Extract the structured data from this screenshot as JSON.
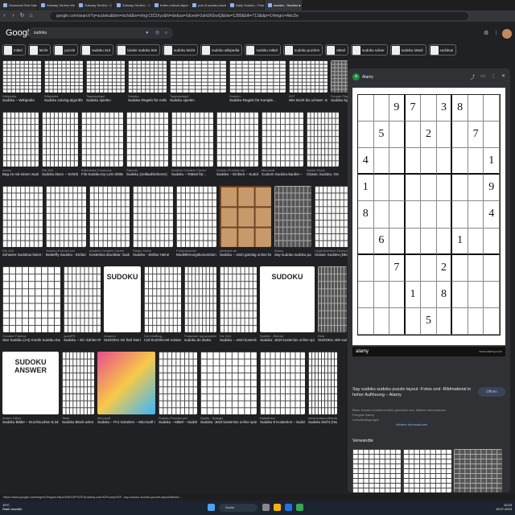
{
  "tabs": [
    {
      "label": "Download Sea Salon Shots Adam - Yo..."
    },
    {
      "label": "Subway Surfers World Tour 2023 - Ho..."
    },
    {
      "label": "Subway Surfers ‹ 1 2023 UR 8R.1.0"
    },
    {
      "label": "Subway Surfers - ‹ Fan..."
    },
    {
      "label": "fruiter-ordinal-object detection on ..."
    },
    {
      "label": "polo 8 sudoku-blank-d - Sudoku v..."
    },
    {
      "label": "Daily Sudoku - Fresh new puzzles 24/7"
    },
    {
      "label": "sudoku - Sudoku ● Google",
      "active": true
    }
  ],
  "address": {
    "url": "google.com/search?q=sudoku&tbm=isch&tbs=rimg:CfZ3Xyz&hl=de&sa=X&ved=2ahUKEwiQ&biw=1280&bih=713&dpr=1#imgrc=AbcDe"
  },
  "header": {
    "logo": "Google",
    "search_query": "sudoku"
  },
  "chips": [
    {
      "label": "mittel"
    },
    {
      "label": "leicht"
    },
    {
      "label": "puzzle"
    },
    {
      "label": "sudoku 3x3"
    },
    {
      "label": "kinder sudoku 9x9"
    },
    {
      "label": "sudoku leicht"
    },
    {
      "label": "sudoku wikipedia"
    },
    {
      "label": "sudoku mittel"
    },
    {
      "label": "sudoku puzzles"
    },
    {
      "label": "rätsel"
    },
    {
      "label": "sudoku solver"
    },
    {
      "label": "sudoku rätsel"
    },
    {
      "label": "sudokus"
    }
  ],
  "rows": [
    {
      "items": [
        {
          "source": "Wikipedia",
          "caption": "Sudoku – Wikipedia",
          "w": 48,
          "h": 40,
          "type": "grid"
        },
        {
          "source": "Wikipedia",
          "caption": "Sudoku solving algorithm...",
          "w": 48,
          "h": 40,
          "type": "grid"
        },
        {
          "source": "Tagesspiegel",
          "caption": "Sudoku spielen",
          "w": 48,
          "h": 40,
          "type": "grid"
        },
        {
          "source": "Sudoku",
          "caption": "Sudoku-Regeln für Anfäng...",
          "w": 48,
          "h": 40,
          "type": "grid"
        },
        {
          "source": "Tagesspiegel",
          "caption": "Sudoku spielen",
          "w": 70,
          "h": 40,
          "type": "grid"
        },
        {
          "source": "Sudoku",
          "caption": "Sudoku-Regeln für Komple...",
          "w": 70,
          "h": 40,
          "type": "grid"
        },
        {
          "source": "9GT",
          "caption": "Wie leicht bis schwer: Su...",
          "w": 48,
          "h": 40,
          "type": "grid"
        },
        {
          "source": "Google Play",
          "caption": "Sudoku by SF27 – Appo...",
          "w": 40,
          "h": 40,
          "type": "dark"
        }
      ]
    },
    {
      "items": [
        {
          "source": "Alamy",
          "caption": "Bag es mit einem Sudoku...",
          "w": 45,
          "h": 68,
          "type": "grid"
        },
        {
          "source": "Die Zeit",
          "caption": "Sudoku lösen – Schritt für...",
          "w": 45,
          "h": 68,
          "type": "grid"
        },
        {
          "source": "Wikimedia Commons",
          "caption": "File:Sudoku-by-L2G-20050...",
          "w": 52,
          "h": 68,
          "type": "grid"
        },
        {
          "source": "Stamatt",
          "caption": "Sudoku (zeitlaufsicheren) – Kanz...",
          "w": 52,
          "h": 68,
          "type": "grid"
        },
        {
          "source": "Another Creative Career",
          "caption": "Sudoku – Rätsel für...",
          "w": 52,
          "h": 68,
          "type": "grid"
        },
        {
          "source": "Sudoku Puzzles.net",
          "caption": "Sudoku – Einfach – Sudoku...",
          "w": 52,
          "h": 68,
          "type": "grid"
        },
        {
          "source": "Microsoft",
          "caption": "Custom Sudoku-kaufen – ...",
          "w": 52,
          "h": 68,
          "type": "grid"
        },
        {
          "source": "Adobe Stock",
          "caption": "Classic Sudoku. Grids with s...",
          "w": 40,
          "h": 68,
          "type": "grid"
        }
      ]
    },
    {
      "items": [
        {
          "source": "Die Zeit",
          "caption": "Schwere Sudokus lösen m...",
          "w": 50,
          "h": 76,
          "type": "grid"
        },
        {
          "source": "Sudoku-Puzzles.net",
          "caption": "Butterfly Sudoku - Einfach...",
          "w": 50,
          "h": 76,
          "type": "grid"
        },
        {
          "source": "Another Creative Career",
          "caption": "Kostenlos druckbar: Sudo...",
          "w": 50,
          "h": 76,
          "type": "grid"
        },
        {
          "source": "Stefan Heine",
          "caption": "Sudoku - Stefan Heine",
          "w": 50,
          "h": 76,
          "type": "grid"
        },
        {
          "source": "Freepresenter",
          "caption": "Modellierungskonventione...",
          "w": 50,
          "h": 76,
          "type": "grid"
        },
        {
          "source": "pinterest.de",
          "caption": "Sudoku – Jetzt günstig online bestelle...",
          "w": 64,
          "h": 76,
          "type": "wood"
        },
        {
          "source": "Alamy",
          "caption": "Say sudoku sudoku puzz...",
          "w": 46,
          "h": 76,
          "type": "dark"
        },
        {
          "source": "Leigh Breichen Deutschland",
          "caption": "Classic Sudoku (DE3) – Kil...",
          "w": 46,
          "h": 76,
          "type": "grid"
        }
      ]
    },
    {
      "items": [
        {
          "source": "Creative Fabrica",
          "caption": "Star Sudoku (A4) Kindle Sudoku Easy Stag...",
          "w": 72,
          "h": 82,
          "type": "grid"
        },
        {
          "source": "openPR",
          "caption": "Sudoku – Ein Zahlen-Rät...",
          "w": 46,
          "h": 82,
          "type": "grid"
        },
        {
          "source": "Amazon",
          "caption": "SUDOKU mit fünf Sterne...",
          "w": 46,
          "h": 82,
          "type": "text",
          "text": "SUDOKU"
        },
        {
          "source": "Die InfoBlog...",
          "caption": "Caf SUDOKUM Advanced",
          "w": 46,
          "h": 82,
          "type": "grid"
        },
        {
          "source": "Podadore wyrazowiemia",
          "caption": "sudoku de druku",
          "w": 40,
          "h": 82,
          "type": "grid"
        },
        {
          "source": "Die Zeit",
          "caption": "Sudoku – Jetzt kostenlos...",
          "w": 46,
          "h": 82,
          "type": "grid"
        },
        {
          "source": "Spielen - Bild.de",
          "caption": "Sudoku: Jetzt kostenlos online spielen",
          "w": 68,
          "h": 82,
          "type": "text",
          "text": "SUDOKU"
        },
        {
          "source": "Ekta",
          "caption": "SUDOKU 400 sudo...",
          "w": 36,
          "h": 82,
          "type": "dark"
        }
      ]
    },
    {
      "items": [
        {
          "source": "Amber Dillon",
          "caption": "Sudoku Bilder – Durchsuchen 8,348 Archiv...",
          "w": 70,
          "h": 78,
          "type": "text",
          "text": "SUDOKU ANSWER"
        },
        {
          "source": "Tobis",
          "caption": "Sudoku Block-arten...",
          "w": 40,
          "h": 78,
          "type": "grid"
        },
        {
          "source": "Microsoft",
          "caption": "Sudoku – Pro-Sobeilen – Microsoft Store de...",
          "w": 72,
          "h": 78,
          "type": "colorful"
        },
        {
          "source": "Sudoku-Puzzles.net",
          "caption": "Sudoku – Mittel – Sudoku...",
          "w": 48,
          "h": 78,
          "type": "grid"
        },
        {
          "source": "Spiele - Spiegel",
          "caption": "Sudoku: Jetzt kostenlos online spielen – D...",
          "w": 70,
          "h": 78,
          "type": "grid"
        },
        {
          "source": "Kabelfranz",
          "caption": "Sudoku 9 Kostenlos – Sudoku Pro Integer F...",
          "w": 56,
          "h": 78,
          "type": "grid"
        },
        {
          "source": "www.sudokuoftheday.com",
          "caption": "Sudoku leicht (Hunderttau...",
          "w": 36,
          "h": 78,
          "type": "grid"
        }
      ]
    }
  ],
  "panel": {
    "source": "Alamy",
    "sudoku": [
      [
        "",
        "",
        "9",
        "7",
        "",
        "3",
        "8",
        "",
        ""
      ],
      [
        "",
        "5",
        "",
        "",
        "2",
        "",
        "",
        "7",
        ""
      ],
      [
        "4",
        "",
        "",
        "",
        "",
        "",
        "",
        "",
        "1"
      ],
      [
        "1",
        "",
        "",
        "",
        "",
        "",
        "",
        "",
        "9"
      ],
      [
        "8",
        "",
        "",
        "",
        "",
        "",
        "",
        "",
        "4"
      ],
      [
        "",
        "6",
        "",
        "",
        "",
        "",
        "1",
        "",
        ""
      ],
      [
        "",
        "",
        "7",
        "",
        "",
        "2",
        "",
        "",
        ""
      ],
      [
        "",
        "",
        "",
        "1",
        "",
        "8",
        "",
        "",
        ""
      ],
      [
        "",
        "",
        "",
        "",
        "5",
        "",
        "",
        "",
        ""
      ]
    ],
    "watermark": "alamy",
    "image_id": "www.alamy.com",
    "title": "Say sudoku sudoku puzzle layout -Fotos und -Bildmaterial in hoher Auflösung – Alamy",
    "visit_label": "Öffnen",
    "meta_line1": "Bilder können urheberrechtlich geschützt sein. Weitere Informationen",
    "meta_line2": "Fotograf: Alamy",
    "meta_line3": "Lizenzbedingungen",
    "meta_more": "Weitere Informationen",
    "related_label": "Verwandte"
  },
  "status_url": "https://www.google.com/imgres?imgurl=https%3A%2F%2Fc8.alamy.com%2Fcomp%2F...say-sudoku-sudoku-puzzle-layout&tbnid=...",
  "taskbar": {
    "weather_temp": "19°C",
    "weather_desc": "Stark bewölkt",
    "search_label": "Suche",
    "time": "10:23",
    "date": "19.07.2023"
  }
}
